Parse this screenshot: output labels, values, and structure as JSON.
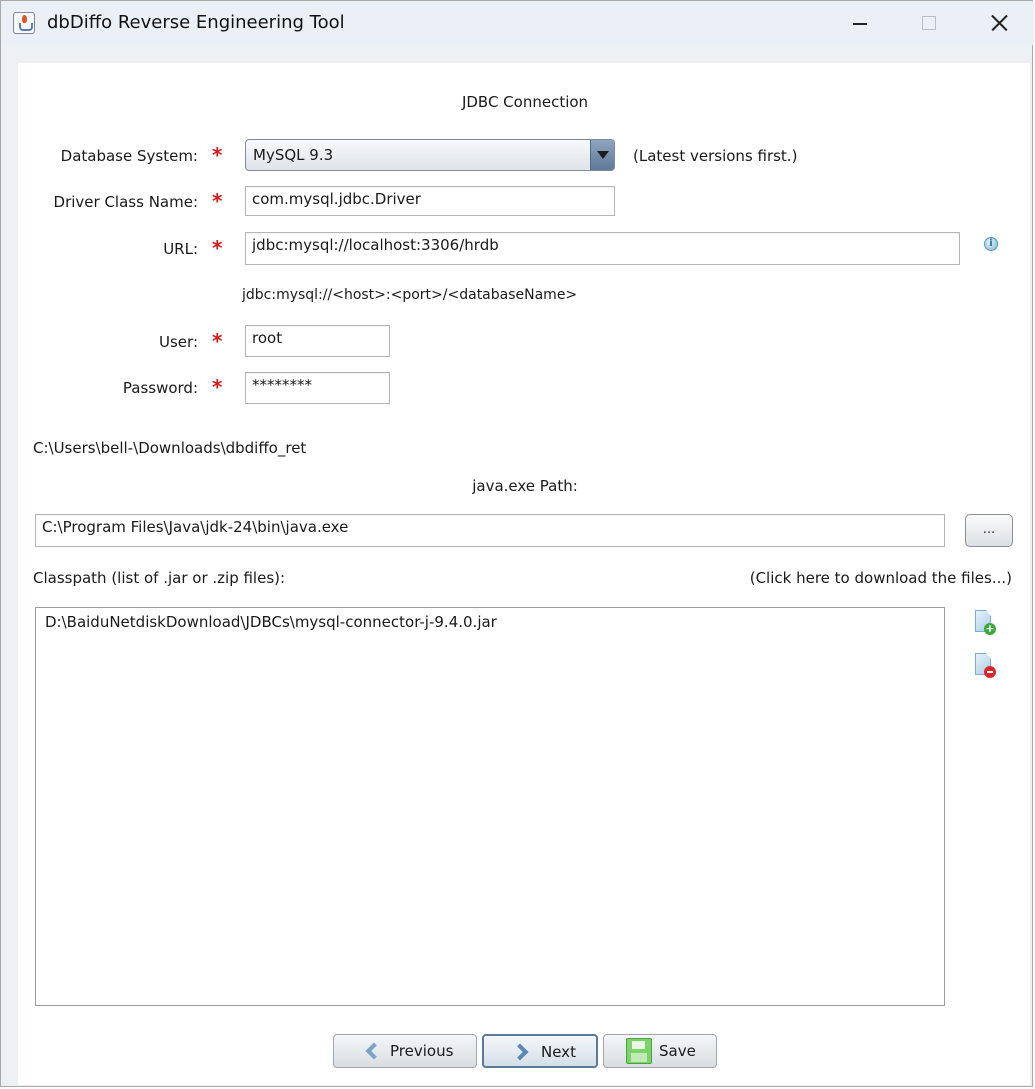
{
  "window": {
    "title": "dbDiffo Reverse Engineering Tool",
    "icon": "java-cup-icon"
  },
  "header": {
    "title": "JDBC Connection"
  },
  "form": {
    "database_system": {
      "label": "Database System:",
      "value": "MySQL 9.3",
      "hint": "(Latest versions first.)"
    },
    "driver_class": {
      "label": "Driver Class Name:",
      "value": "com.mysql.jdbc.Driver"
    },
    "url": {
      "label": "URL:",
      "value": "jdbc:mysql://localhost:3306/hrdb",
      "hint": "jdbc:mysql://<host>:<port>/<databaseName>"
    },
    "user": {
      "label": "User:",
      "value": "root"
    },
    "password": {
      "label": "Password:",
      "value": "********"
    },
    "required_mark": "*"
  },
  "working_dir": "C:\\Users\\bell-\\Downloads\\dbdiffo_ret",
  "java_path": {
    "label": "java.exe Path:",
    "value": "C:\\Program Files\\Java\\jdk-24\\bin\\java.exe",
    "browse_label": "..."
  },
  "classpath": {
    "label": "Classpath (list of .jar or .zip files):",
    "download_link": "(Click here to download the files...)",
    "items": [
      "D:\\BaiduNetdiskDownload\\JDBCs\\mysql-connector-j-9.4.0.jar"
    ]
  },
  "buttons": {
    "previous": "Previous",
    "next": "Next",
    "save": "Save"
  },
  "colors": {
    "required": "#d61a1a",
    "titlebar": "#eaf0f6",
    "accent": "#5a7a9c"
  }
}
